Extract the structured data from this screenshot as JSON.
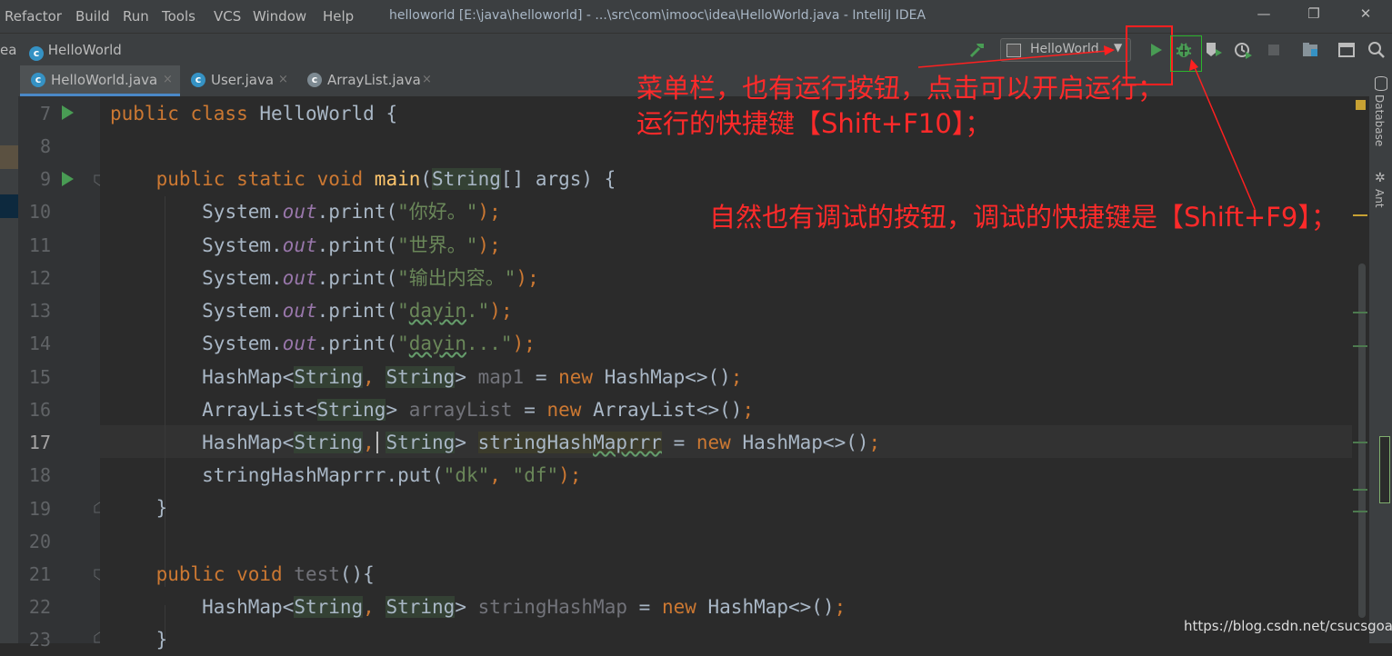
{
  "colors": {
    "keyword": "#cc7832",
    "function": "#ffc66d",
    "string": "#6a8759",
    "field": "#9876aa",
    "run_green": "#499c54",
    "annotation_red": "#ff2a2a"
  },
  "menubar": {
    "items": [
      "Refactor",
      "Build",
      "Run",
      "Tools",
      "VCS",
      "Window",
      "Help"
    ],
    "window_title": "helloworld [E:\\java\\helloworld] - ...\\src\\com\\imooc\\idea\\HelloWorld.java - IntelliJ IDEA",
    "minimize": "—",
    "maximize": "❐",
    "close": "✕"
  },
  "navbar": {
    "crumb_prefix": "ea",
    "crumb_file": "HelloWorld",
    "run_config": "HelloWorld",
    "icons": [
      "hammer-build-icon",
      "run-icon",
      "debug-bug-icon",
      "coverage-icon",
      "profile-icon",
      "stop-icon",
      "project-structure-icon",
      "terminal-icon",
      "search-icon"
    ]
  },
  "tabs": [
    {
      "label": "HelloWorld.java",
      "close": "×"
    },
    {
      "label": "User.java",
      "close": "×"
    },
    {
      "label": "ArrayList.java",
      "close": "×"
    }
  ],
  "editor": {
    "line_numbers": [
      "7",
      "8",
      "9",
      "10",
      "11",
      "12",
      "13",
      "14",
      "15",
      "16",
      "17",
      "18",
      "19",
      "20",
      "21",
      "22",
      "23"
    ],
    "lines": {
      "l7": {
        "t1": "public class ",
        "t2": "HelloWorld {"
      },
      "l9": {
        "t1": "public static void ",
        "t2": "main",
        "t3": "(",
        "t4": "String",
        "t5": "[] args) {"
      },
      "l10": {
        "t1": "System.",
        "t2": "out",
        "t3": ".print(",
        "t4": "\"你好。\"",
        "t5": ");"
      },
      "l11": {
        "t1": "System.",
        "t2": "out",
        "t3": ".print(",
        "t4": "\"世界。\"",
        "t5": ");"
      },
      "l12": {
        "t1": "System.",
        "t2": "out",
        "t3": ".print(",
        "t4": "\"输出内容。\"",
        "t5": ");"
      },
      "l13": {
        "t1": "System.",
        "t2": "out",
        "t3": ".print(",
        "t4a": "\"",
        "t4b": "dayin",
        "t4c": ".\"",
        "t5": ");"
      },
      "l14": {
        "t1": "System.",
        "t2": "out",
        "t3": ".print(",
        "t4a": "\"",
        "t4b": "dayin",
        "t4c": "...\"",
        "t5": ");"
      },
      "l15": {
        "t1": "HashMap<",
        "t2": "String",
        "t3": ", ",
        "t4": "String",
        "t5": "> ",
        "t6": "map1",
        "t7": " = ",
        "t8": "new ",
        "t9": "HashMap<>()",
        "t10": ";"
      },
      "l16": {
        "t1": "ArrayList<",
        "t2": "String",
        "t3": "> ",
        "t4": "arrayList",
        "t5": " = ",
        "t6": "new ",
        "t7": "ArrayList<>()",
        "t8": ";"
      },
      "l17": {
        "t1": "HashMap<",
        "t2": "String",
        "t3": ", ",
        "t4": "String",
        "t5": "> ",
        "t6a": "stringHash",
        "t6b": "Maprrr",
        "t7": " = ",
        "t8": "new ",
        "t9": "HashMap<>()",
        "t10": ";"
      },
      "l18": {
        "t1": "stringHashMaprrr.put(",
        "t2": "\"dk\"",
        "t3": ", ",
        "t4": "\"df\"",
        "t5": ");"
      },
      "l19": {
        "t1": "}"
      },
      "l21": {
        "t1": "public void ",
        "t2": "test",
        "t3": "(){"
      },
      "l22": {
        "t1": "HashMap<",
        "t2": "String",
        "t3": ", ",
        "t4": "String",
        "t5": "> ",
        "t6": "stringHashMap",
        "t7": " = ",
        "t8": "new ",
        "t9": "HashMap<>()",
        "t10": ";"
      },
      "l23": {
        "t1": "}"
      }
    }
  },
  "right_strip": {
    "database": "Database",
    "ant": "Ant"
  },
  "annotations": {
    "menu_run_line1": "菜单栏，也有运行按钮，点击可以开启运行；",
    "menu_run_line2": "运行的快捷键【Shift+F10】；",
    "debug_note": "自然也有调试的按钮，调试的快捷键是【Shift+F9】；"
  },
  "watermark": "https://blog.csdn.net/csucsgoat"
}
